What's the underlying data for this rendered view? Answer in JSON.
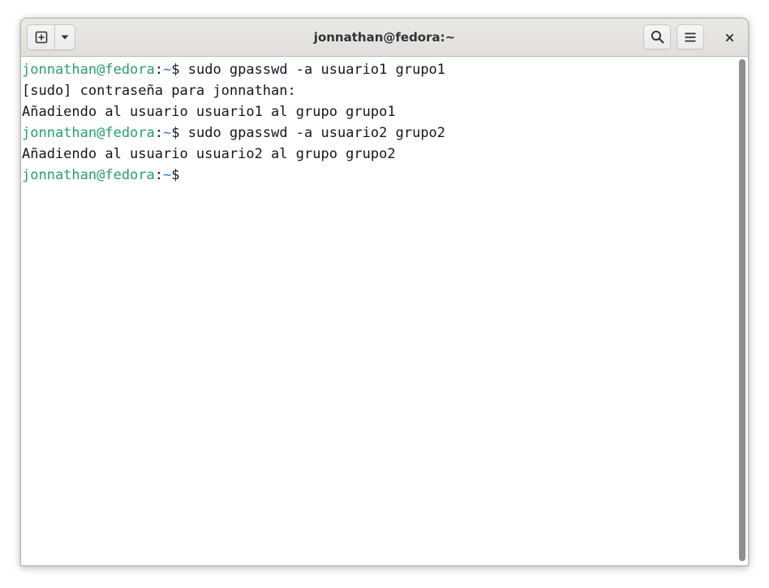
{
  "window": {
    "title": "jonnathan@fedora:~"
  },
  "headerbar": {
    "new_tab_icon": "plus-square-icon",
    "menu_dropdown_icon": "chevron-down-icon",
    "search_icon": "search-icon",
    "hamburger_icon": "hamburger-menu-icon",
    "close_icon": "close-icon"
  },
  "terminal": {
    "lines": [
      {
        "type": "prompt",
        "user": "jonnathan@fedora",
        "sep": ":",
        "path": "~",
        "symbol": "$",
        "command": " sudo gpasswd -a usuario1 grupo1"
      },
      {
        "type": "output",
        "text": "[sudo] contraseña para jonnathan:"
      },
      {
        "type": "output",
        "text": "Añadiendo al usuario usuario1 al grupo grupo1"
      },
      {
        "type": "prompt",
        "user": "jonnathan@fedora",
        "sep": ":",
        "path": "~",
        "symbol": "$",
        "command": " sudo gpasswd -a usuario2 grupo2"
      },
      {
        "type": "output",
        "text": "Añadiendo al usuario usuario2 al grupo grupo2"
      },
      {
        "type": "prompt",
        "user": "jonnathan@fedora",
        "sep": ":",
        "path": "~",
        "symbol": "$",
        "command": ""
      }
    ]
  },
  "colors": {
    "prompt_user": "#26a269",
    "prompt_path": "#2a7bde",
    "text": "#171421",
    "background": "#ffffff",
    "scrollbar": "#8d9092"
  }
}
